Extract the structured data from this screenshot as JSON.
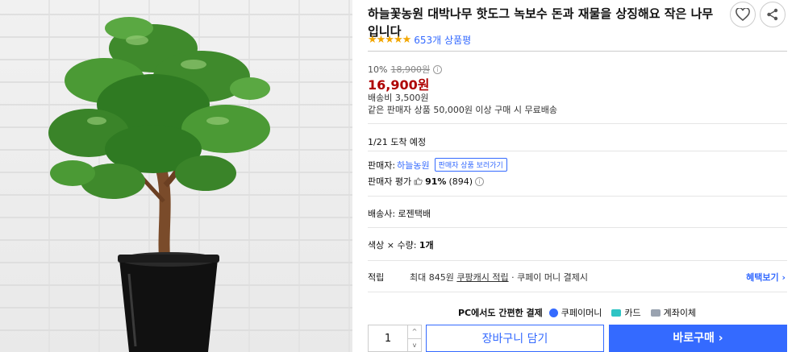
{
  "product": {
    "title": "하늘꽃농원 대박나무 핫도그 녹보수 돈과 재물을 상징해요 작은 나무입니다",
    "rating_stars": "★★★★★",
    "review_count": "653개 상품평"
  },
  "price": {
    "discount_rate": "10%",
    "original_price": "18,900원",
    "info_glyph": "i",
    "sale_price": "16,900원",
    "shipping_fee": "배송비 3,500원",
    "free_shipping_note": "같은 판매자 상품 50,000원 이상 구매 시 무료배송"
  },
  "arrival": "1/21 도착 예정",
  "seller": {
    "label": "판매자:",
    "name": "하늘농원",
    "view_products_label": "판매자 상품 보러가기",
    "score_label": "판매자 평가",
    "score_value": "91%",
    "score_count": "(894)"
  },
  "delivery": "배송사: 로젠택배",
  "option": {
    "label": "색상 × 수량:",
    "value": "1개"
  },
  "reward": {
    "label": "적립",
    "prefix": "최대 845원",
    "link": "쿠팡캐시 적립",
    "suffix": " · 쿠페이 머니 결제시",
    "benefit_label": "혜택보기 ›"
  },
  "pay": {
    "label": "PC에서도 간편한 결제",
    "methods": [
      "쿠페이머니",
      "카드",
      "계좌이체"
    ]
  },
  "actions": {
    "quantity": "1",
    "qty_up": "^",
    "qty_down": "v",
    "cart_label": "장바구니 담기",
    "buy_label": "바로구매 ›"
  },
  "colors": {
    "accent": "#346aff",
    "price": "#ae0000",
    "star": "#f2a600"
  },
  "icons": [
    "heart-icon",
    "share-icon",
    "info-icon",
    "thumbs-up-icon",
    "coupay-icon",
    "card-icon",
    "bank-icon"
  ]
}
